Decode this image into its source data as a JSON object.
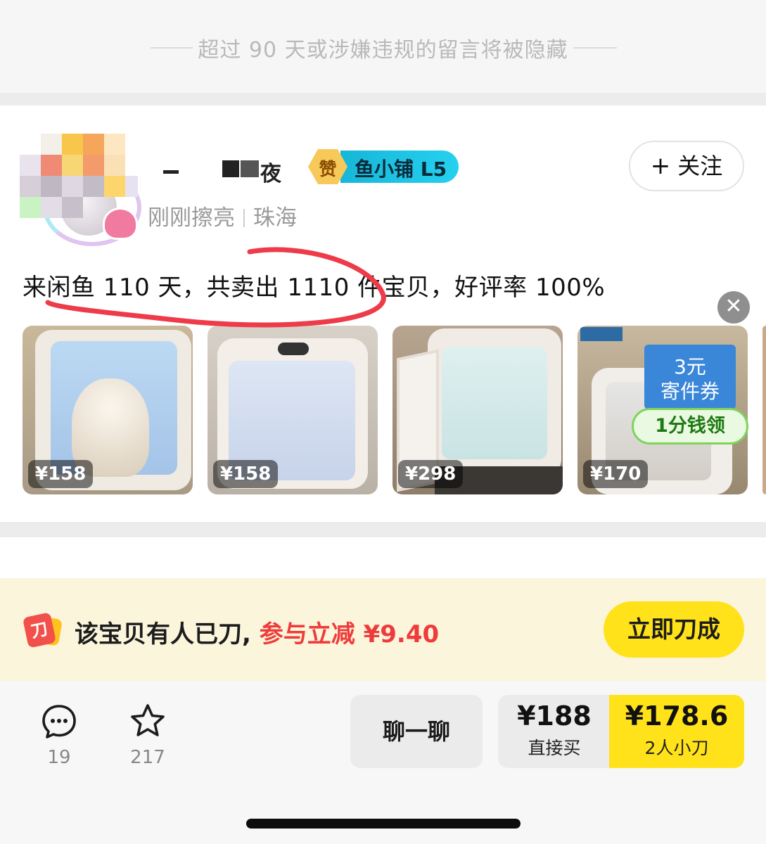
{
  "notice": {
    "text": "超过 90 天或涉嫌违规的留言将被隐藏"
  },
  "seller": {
    "name": "▁ ▄▄▄夜",
    "badge_zan": "赞",
    "badge_shop": "鱼小铺 L5",
    "follow_label": "关注",
    "activity": "刚刚擦亮",
    "location": "珠海",
    "stats": "来闲鱼 110 天，共卖出 1110 件宝贝，好评率 100%"
  },
  "products": [
    {
      "price": "¥158"
    },
    {
      "price": "¥158"
    },
    {
      "price": "¥298"
    },
    {
      "price": "¥170"
    }
  ],
  "coupon": {
    "amount": "3元",
    "label": "寄件券",
    "action": "1分钱领"
  },
  "bargain": {
    "text": "该宝贝有人已刀,",
    "highlight": "参与立减 ¥9.40",
    "button": "立即刀成",
    "highlight_color": "#ef3b3b",
    "button_color": "#ffe21a"
  },
  "footer": {
    "comments": "19",
    "favorites": "217",
    "chat_label": "聊一聊",
    "buy_price": "¥188",
    "buy_label": "直接买",
    "cut_price": "¥178.6",
    "cut_label": "2人小刀"
  },
  "icons": [
    "close-icon",
    "plus-icon",
    "knife-icon",
    "comment-icon",
    "star-icon"
  ]
}
